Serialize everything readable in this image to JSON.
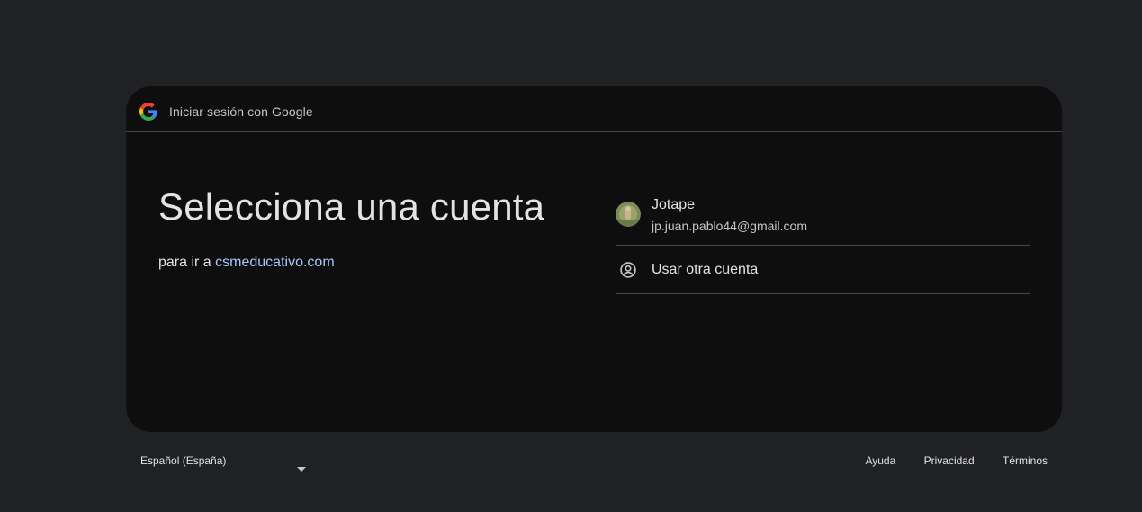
{
  "header": {
    "title": "Iniciar sesión con Google",
    "logo_icon": "google-g-icon"
  },
  "main": {
    "headline": "Selecciona una cuenta",
    "subline_prefix": "para ir a",
    "subline_link": "csmeducativo.com"
  },
  "accounts": [
    {
      "name": "Jotape",
      "email": "jp.juan.pablo44@gmail.com",
      "avatar_icon": "user-avatar"
    }
  ],
  "use_other": {
    "label": "Usar otra cuenta",
    "icon": "account-circle-icon"
  },
  "footer": {
    "language": "Español (España)",
    "links": [
      "Ayuda",
      "Privacidad",
      "Términos"
    ]
  },
  "colors": {
    "background": "#202124",
    "card": "#0e0e0e",
    "link": "#a8c7fa",
    "divider": "#444746"
  }
}
